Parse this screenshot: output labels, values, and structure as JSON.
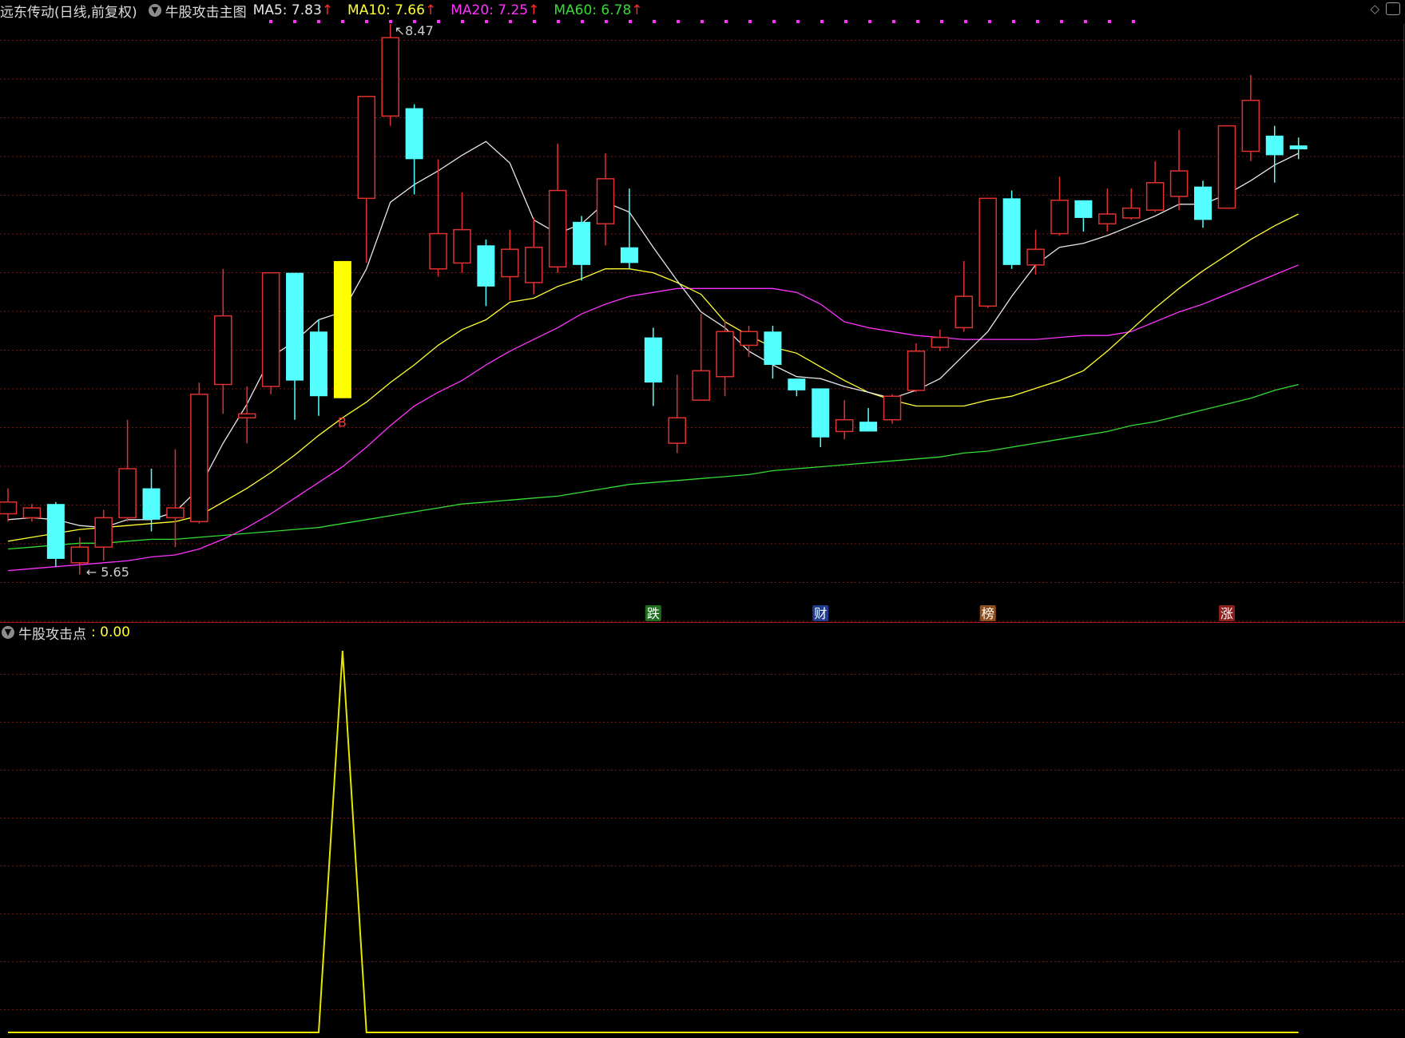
{
  "header": {
    "stock_title": "远东传动(日线,前复权)",
    "indicator_title": "牛股攻击主图",
    "ma": [
      {
        "label": "MA5: 7.83",
        "color": "#e6e6e6"
      },
      {
        "label": "MA10: 7.66",
        "color": "#ffff33"
      },
      {
        "label": "MA20: 7.25",
        "color": "#ff33ff"
      },
      {
        "label": "MA60: 6.78",
        "color": "#33dd33"
      }
    ],
    "arrow_glyph": "↑",
    "icons": [
      "chevron-down-icon",
      "diamond-icon",
      "window-icon"
    ]
  },
  "annotations": {
    "high": "8.47",
    "low": "5.65",
    "buy": "B"
  },
  "news_markers": [
    {
      "label": "跌",
      "bg": "#1f6e1f",
      "fg": "#ffffff"
    },
    {
      "label": "财",
      "bg": "#1f3f8e",
      "fg": "#ffffff"
    },
    {
      "label": "榜",
      "bg": "#8e4f1f",
      "fg": "#ffffff"
    },
    {
      "label": "涨",
      "bg": "#8e1f1f",
      "fg": "#ffffff"
    }
  ],
  "sub_header": {
    "name": "牛股攻击点",
    "value": ": 0.00"
  },
  "colors": {
    "up": "#e03030",
    "down": "#54ffff",
    "signal": "#ffff00",
    "grid": "#7a1515",
    "ma5": "#e6e6e6",
    "ma10": "#ffff33",
    "ma20": "#ff33ff",
    "ma60": "#33dd33",
    "indicator_line": "#e6e600"
  },
  "chart_data": {
    "type": "candlestick",
    "price_high_label": 8.47,
    "price_low_label": 5.65,
    "candles": [
      {
        "o": 5.97,
        "c": 6.03,
        "h": 6.1,
        "l": 5.93
      },
      {
        "o": 5.95,
        "c": 6.0,
        "h": 6.02,
        "l": 5.93
      },
      {
        "o": 6.02,
        "c": 5.74,
        "h": 6.03,
        "l": 5.7
      },
      {
        "o": 5.72,
        "c": 5.8,
        "h": 5.85,
        "l": 5.66
      },
      {
        "o": 5.8,
        "c": 5.95,
        "h": 5.99,
        "l": 5.73
      },
      {
        "o": 5.95,
        "c": 6.2,
        "h": 6.45,
        "l": 5.93
      },
      {
        "o": 6.1,
        "c": 5.94,
        "h": 6.2,
        "l": 5.88
      },
      {
        "o": 5.95,
        "c": 6.0,
        "h": 6.3,
        "l": 5.8
      },
      {
        "o": 5.93,
        "c": 6.58,
        "h": 6.64,
        "l": 5.92
      },
      {
        "o": 6.63,
        "c": 6.98,
        "h": 7.22,
        "l": 6.48
      },
      {
        "o": 6.46,
        "c": 6.48,
        "h": 6.62,
        "l": 6.33
      },
      {
        "o": 6.62,
        "c": 7.2,
        "h": 7.2,
        "l": 6.58
      },
      {
        "o": 7.2,
        "c": 6.65,
        "h": 7.2,
        "l": 6.45
      },
      {
        "o": 6.9,
        "c": 6.57,
        "h": 6.96,
        "l": 6.47
      },
      {
        "o": 6.56,
        "c": 7.26,
        "h": 7.26,
        "l": 6.56,
        "signal": true
      },
      {
        "o": 7.58,
        "c": 8.1,
        "h": 8.1,
        "l": 7.25
      },
      {
        "o": 8.0,
        "c": 8.4,
        "h": 8.47,
        "l": 7.95
      },
      {
        "o": 8.04,
        "c": 7.78,
        "h": 8.06,
        "l": 7.6
      },
      {
        "o": 7.22,
        "c": 7.4,
        "h": 7.78,
        "l": 7.18
      },
      {
        "o": 7.25,
        "c": 7.42,
        "h": 7.61,
        "l": 7.2
      },
      {
        "o": 7.34,
        "c": 7.13,
        "h": 7.37,
        "l": 7.03
      },
      {
        "o": 7.18,
        "c": 7.32,
        "h": 7.42,
        "l": 7.06
      },
      {
        "o": 7.15,
        "c": 7.33,
        "h": 7.48,
        "l": 7.09
      },
      {
        "o": 7.23,
        "c": 7.62,
        "h": 7.86,
        "l": 7.2
      },
      {
        "o": 7.46,
        "c": 7.24,
        "h": 7.49,
        "l": 7.16
      },
      {
        "o": 7.45,
        "c": 7.68,
        "h": 7.81,
        "l": 7.34
      },
      {
        "o": 7.33,
        "c": 7.25,
        "h": 7.63,
        "l": 7.22
      },
      {
        "o": 6.87,
        "c": 6.64,
        "h": 6.92,
        "l": 6.52
      },
      {
        "o": 6.33,
        "c": 6.46,
        "h": 6.68,
        "l": 6.28
      },
      {
        "o": 6.55,
        "c": 6.7,
        "h": 6.99,
        "l": 6.55
      },
      {
        "o": 6.67,
        "c": 6.9,
        "h": 6.96,
        "l": 6.57
      },
      {
        "o": 6.83,
        "c": 6.9,
        "h": 6.93,
        "l": 6.77
      },
      {
        "o": 6.9,
        "c": 6.73,
        "h": 6.93,
        "l": 6.66
      },
      {
        "o": 6.66,
        "c": 6.6,
        "h": 6.66,
        "l": 6.57
      },
      {
        "o": 6.61,
        "c": 6.36,
        "h": 6.61,
        "l": 6.31
      },
      {
        "o": 6.39,
        "c": 6.45,
        "h": 6.55,
        "l": 6.35
      },
      {
        "o": 6.44,
        "c": 6.39,
        "h": 6.51,
        "l": 6.42
      },
      {
        "o": 6.45,
        "c": 6.57,
        "h": 6.58,
        "l": 6.43
      },
      {
        "o": 6.6,
        "c": 6.8,
        "h": 6.84,
        "l": 6.59
      },
      {
        "o": 6.82,
        "c": 6.87,
        "h": 6.91,
        "l": 6.8
      },
      {
        "o": 6.92,
        "c": 7.08,
        "h": 7.26,
        "l": 6.9
      },
      {
        "o": 7.03,
        "c": 7.58,
        "h": 7.58,
        "l": 7.02
      },
      {
        "o": 7.58,
        "c": 7.24,
        "h": 7.62,
        "l": 7.22
      },
      {
        "o": 7.24,
        "c": 7.32,
        "h": 7.42,
        "l": 7.19
      },
      {
        "o": 7.4,
        "c": 7.57,
        "h": 7.69,
        "l": 7.39
      },
      {
        "o": 7.57,
        "c": 7.48,
        "h": 7.57,
        "l": 7.41
      },
      {
        "o": 7.45,
        "c": 7.5,
        "h": 7.63,
        "l": 7.41
      },
      {
        "o": 7.48,
        "c": 7.53,
        "h": 7.63,
        "l": 7.47
      },
      {
        "o": 7.52,
        "c": 7.66,
        "h": 7.77,
        "l": 7.51
      },
      {
        "o": 7.59,
        "c": 7.72,
        "h": 7.93,
        "l": 7.52
      },
      {
        "o": 7.64,
        "c": 7.47,
        "h": 7.67,
        "l": 7.43
      },
      {
        "o": 7.53,
        "c": 7.95,
        "h": 7.95,
        "l": 7.54
      },
      {
        "o": 7.82,
        "c": 8.08,
        "h": 8.21,
        "l": 7.77
      },
      {
        "o": 7.9,
        "c": 7.8,
        "h": 7.95,
        "l": 7.66
      },
      {
        "o": 7.85,
        "c": 7.83,
        "h": 7.89,
        "l": 7.78
      }
    ],
    "ma5": [
      5.94,
      5.95,
      5.94,
      5.91,
      5.9,
      5.94,
      5.94,
      5.98,
      6.1,
      6.33,
      6.53,
      6.77,
      6.85,
      6.96,
      7.0,
      7.22,
      7.56,
      7.65,
      7.72,
      7.8,
      7.87,
      7.76,
      7.47,
      7.4,
      7.45,
      7.56,
      7.51,
      7.33,
      7.16,
      7.0,
      6.92,
      6.8,
      6.73,
      6.67,
      6.66,
      6.62,
      6.59,
      6.56,
      6.6,
      6.66,
      6.78,
      6.9,
      7.08,
      7.24,
      7.33,
      7.35,
      7.39,
      7.44,
      7.49,
      7.55,
      7.55,
      7.6,
      7.67,
      7.75,
      7.81
    ],
    "ma10": [
      5.83,
      5.85,
      5.87,
      5.89,
      5.9,
      5.91,
      5.92,
      5.93,
      5.96,
      6.03,
      6.1,
      6.18,
      6.27,
      6.37,
      6.46,
      6.54,
      6.64,
      6.73,
      6.83,
      6.91,
      6.96,
      7.05,
      7.07,
      7.13,
      7.17,
      7.22,
      7.22,
      7.2,
      7.15,
      7.09,
      6.95,
      6.88,
      6.82,
      6.79,
      6.72,
      6.65,
      6.59,
      6.55,
      6.52,
      6.52,
      6.52,
      6.55,
      6.57,
      6.61,
      6.65,
      6.7,
      6.8,
      6.91,
      7.02,
      7.12,
      7.21,
      7.29,
      7.37,
      7.44,
      7.5
    ],
    "ma20": [
      5.68,
      5.69,
      5.7,
      5.71,
      5.72,
      5.73,
      5.75,
      5.76,
      5.79,
      5.84,
      5.9,
      5.97,
      6.05,
      6.13,
      6.21,
      6.31,
      6.42,
      6.52,
      6.59,
      6.65,
      6.73,
      6.8,
      6.86,
      6.92,
      6.99,
      7.04,
      7.08,
      7.1,
      7.12,
      7.12,
      7.12,
      7.12,
      7.12,
      7.1,
      7.04,
      6.95,
      6.92,
      6.9,
      6.88,
      6.87,
      6.86,
      6.86,
      6.86,
      6.86,
      6.87,
      6.88,
      6.88,
      6.9,
      6.95,
      7.0,
      7.04,
      7.09,
      7.14,
      7.19,
      7.24
    ],
    "ma60": [
      5.79,
      5.8,
      5.81,
      5.82,
      5.82,
      5.83,
      5.84,
      5.84,
      5.85,
      5.86,
      5.87,
      5.88,
      5.89,
      5.9,
      5.92,
      5.94,
      5.96,
      5.98,
      6.0,
      6.02,
      6.03,
      6.04,
      6.05,
      6.06,
      6.08,
      6.1,
      6.12,
      6.13,
      6.14,
      6.15,
      6.16,
      6.17,
      6.19,
      6.2,
      6.21,
      6.22,
      6.23,
      6.24,
      6.25,
      6.26,
      6.28,
      6.29,
      6.31,
      6.33,
      6.35,
      6.37,
      6.39,
      6.42,
      6.44,
      6.47,
      6.5,
      6.53,
      6.56,
      6.6,
      6.63
    ],
    "indicator": {
      "name": "牛股攻击点",
      "values": [
        0,
        0,
        0,
        0,
        0,
        0,
        0,
        0,
        0,
        0,
        0,
        0,
        0,
        0,
        1,
        0,
        0,
        0,
        0,
        0,
        0,
        0,
        0,
        0,
        0,
        0,
        0,
        0,
        0,
        0,
        0,
        0,
        0,
        0,
        0,
        0,
        0,
        0,
        0,
        0,
        0,
        0,
        0,
        0,
        0,
        0,
        0,
        0,
        0,
        0,
        0,
        0,
        0,
        0,
        0
      ],
      "current": 0
    },
    "news_marker_candle": [
      27,
      34,
      41,
      51
    ]
  }
}
